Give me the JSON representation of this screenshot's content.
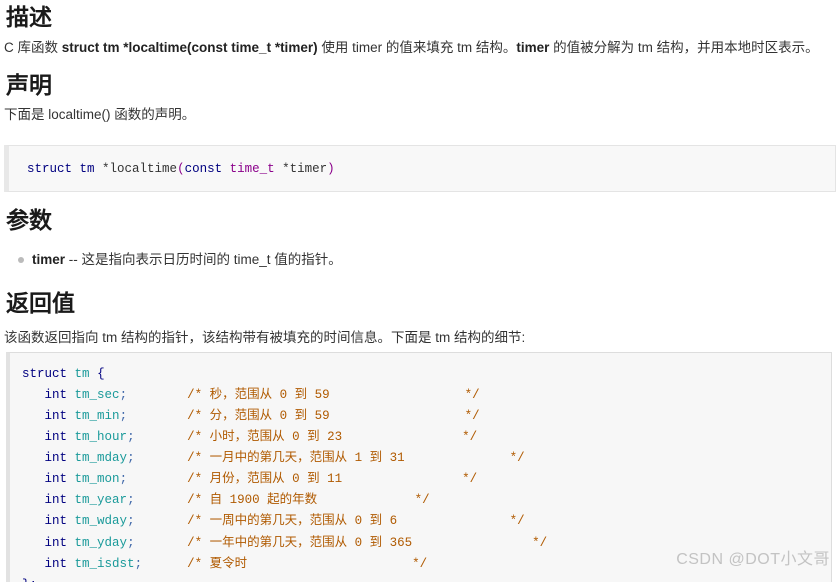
{
  "sections": {
    "description": {
      "title": "描述",
      "text_parts": {
        "lead": "C 库函数 ",
        "signature": "struct tm *localtime(const time_t *timer)",
        "mid": " 使用 ",
        "timer1": "timer",
        "mid2": " 的值来填充 ",
        "tm1": "tm",
        "mid3": " 结构。",
        "timer2": "timer",
        "mid4": " 的值被分解为 ",
        "tm2": "tm",
        "tail": " 结构，并用本地时区表示。"
      }
    },
    "declaration": {
      "title": "声明",
      "text": "下面是 localtime() 函数的声明。",
      "code": {
        "tokens": [
          {
            "t": "struct",
            "c": "kw"
          },
          {
            "t": " ",
            "c": "ident"
          },
          {
            "t": "tm",
            "c": "kw"
          },
          {
            "t": " *localtime",
            "c": "ident"
          },
          {
            "t": "(",
            "c": "punc"
          },
          {
            "t": "const",
            "c": "kw"
          },
          {
            "t": " ",
            "c": "ident"
          },
          {
            "t": "time_t",
            "c": "type"
          },
          {
            "t": " *timer",
            "c": "ident"
          },
          {
            "t": ")",
            "c": "punc"
          }
        ],
        "plain": "struct tm *localtime(const time_t *timer)"
      }
    },
    "parameters": {
      "title": "参数",
      "items": [
        {
          "name": "timer",
          "separator": " -- ",
          "desc_a": "这是指向表示日历时间的 ",
          "type": "time_t",
          "desc_b": " 值的指针。"
        }
      ]
    },
    "return_value": {
      "title": "返回值",
      "text_a": "该函数返回指向 ",
      "tm_a": "tm",
      "text_b": " 结构的指针，该结构带有被填充的时间信息。下面是 ",
      "tm_b": "tm",
      "text_c": " 结构的细节:",
      "code_lines": [
        {
          "indent": 0,
          "decl": [
            {
              "t": "struct",
              "c": "kw"
            },
            {
              "t": " ",
              "c": "ident"
            },
            {
              "t": "tm",
              "c": "ident2"
            },
            {
              "t": " ",
              "c": "ident"
            },
            {
              "t": "{",
              "c": "brace"
            }
          ],
          "comment": ""
        },
        {
          "indent": 1,
          "decl": [
            {
              "t": "int",
              "c": "kw"
            },
            {
              "t": " ",
              "c": "ident"
            },
            {
              "t": "tm_sec",
              "c": "ident2"
            },
            {
              "t": ";",
              "c": "semi"
            }
          ],
          "comment": "/* 秒，范围从 0 到 59                  */"
        },
        {
          "indent": 1,
          "decl": [
            {
              "t": "int",
              "c": "kw"
            },
            {
              "t": " ",
              "c": "ident"
            },
            {
              "t": "tm_min",
              "c": "ident2"
            },
            {
              "t": ";",
              "c": "semi"
            }
          ],
          "comment": "/* 分，范围从 0 到 59                  */"
        },
        {
          "indent": 1,
          "decl": [
            {
              "t": "int",
              "c": "kw"
            },
            {
              "t": " ",
              "c": "ident"
            },
            {
              "t": "tm_hour",
              "c": "ident2"
            },
            {
              "t": ";",
              "c": "semi"
            }
          ],
          "comment": "/* 小时，范围从 0 到 23                */"
        },
        {
          "indent": 1,
          "decl": [
            {
              "t": "int",
              "c": "kw"
            },
            {
              "t": " ",
              "c": "ident"
            },
            {
              "t": "tm_mday",
              "c": "ident2"
            },
            {
              "t": ";",
              "c": "semi"
            }
          ],
          "comment": "/* 一月中的第几天，范围从 1 到 31              */"
        },
        {
          "indent": 1,
          "decl": [
            {
              "t": "int",
              "c": "kw"
            },
            {
              "t": " ",
              "c": "ident"
            },
            {
              "t": "tm_mon",
              "c": "ident2"
            },
            {
              "t": ";",
              "c": "semi"
            }
          ],
          "comment": "/* 月份，范围从 0 到 11                */"
        },
        {
          "indent": 1,
          "decl": [
            {
              "t": "int",
              "c": "kw"
            },
            {
              "t": " ",
              "c": "ident"
            },
            {
              "t": "tm_year",
              "c": "ident2"
            },
            {
              "t": ";",
              "c": "semi"
            }
          ],
          "comment": "/* 自 1900 起的年数             */"
        },
        {
          "indent": 1,
          "decl": [
            {
              "t": "int",
              "c": "kw"
            },
            {
              "t": " ",
              "c": "ident"
            },
            {
              "t": "tm_wday",
              "c": "ident2"
            },
            {
              "t": ";",
              "c": "semi"
            }
          ],
          "comment": "/* 一周中的第几天，范围从 0 到 6               */"
        },
        {
          "indent": 1,
          "decl": [
            {
              "t": "int",
              "c": "kw"
            },
            {
              "t": " ",
              "c": "ident"
            },
            {
              "t": "tm_yday",
              "c": "ident2"
            },
            {
              "t": ";",
              "c": "semi"
            }
          ],
          "comment": "/* 一年中的第几天，范围从 0 到 365                */"
        },
        {
          "indent": 1,
          "decl": [
            {
              "t": "int",
              "c": "kw"
            },
            {
              "t": " ",
              "c": "ident"
            },
            {
              "t": "tm_isdst",
              "c": "ident2"
            },
            {
              "t": ";",
              "c": "semi"
            }
          ],
          "comment": "/* 夏令时                      */"
        },
        {
          "indent": 0,
          "decl": [
            {
              "t": "};",
              "c": "brace"
            }
          ],
          "comment": ""
        }
      ]
    }
  },
  "watermark": "CSDN @DOT小文哥",
  "colors": {
    "keyword": "#000080",
    "type": "#8b008b",
    "identifier": "#1a9a9a",
    "comment": "#b05a00",
    "text": "#333333",
    "heading": "#1a1a1a",
    "code_bg": "#f7f7f7",
    "watermark": "#c3c3c3"
  }
}
